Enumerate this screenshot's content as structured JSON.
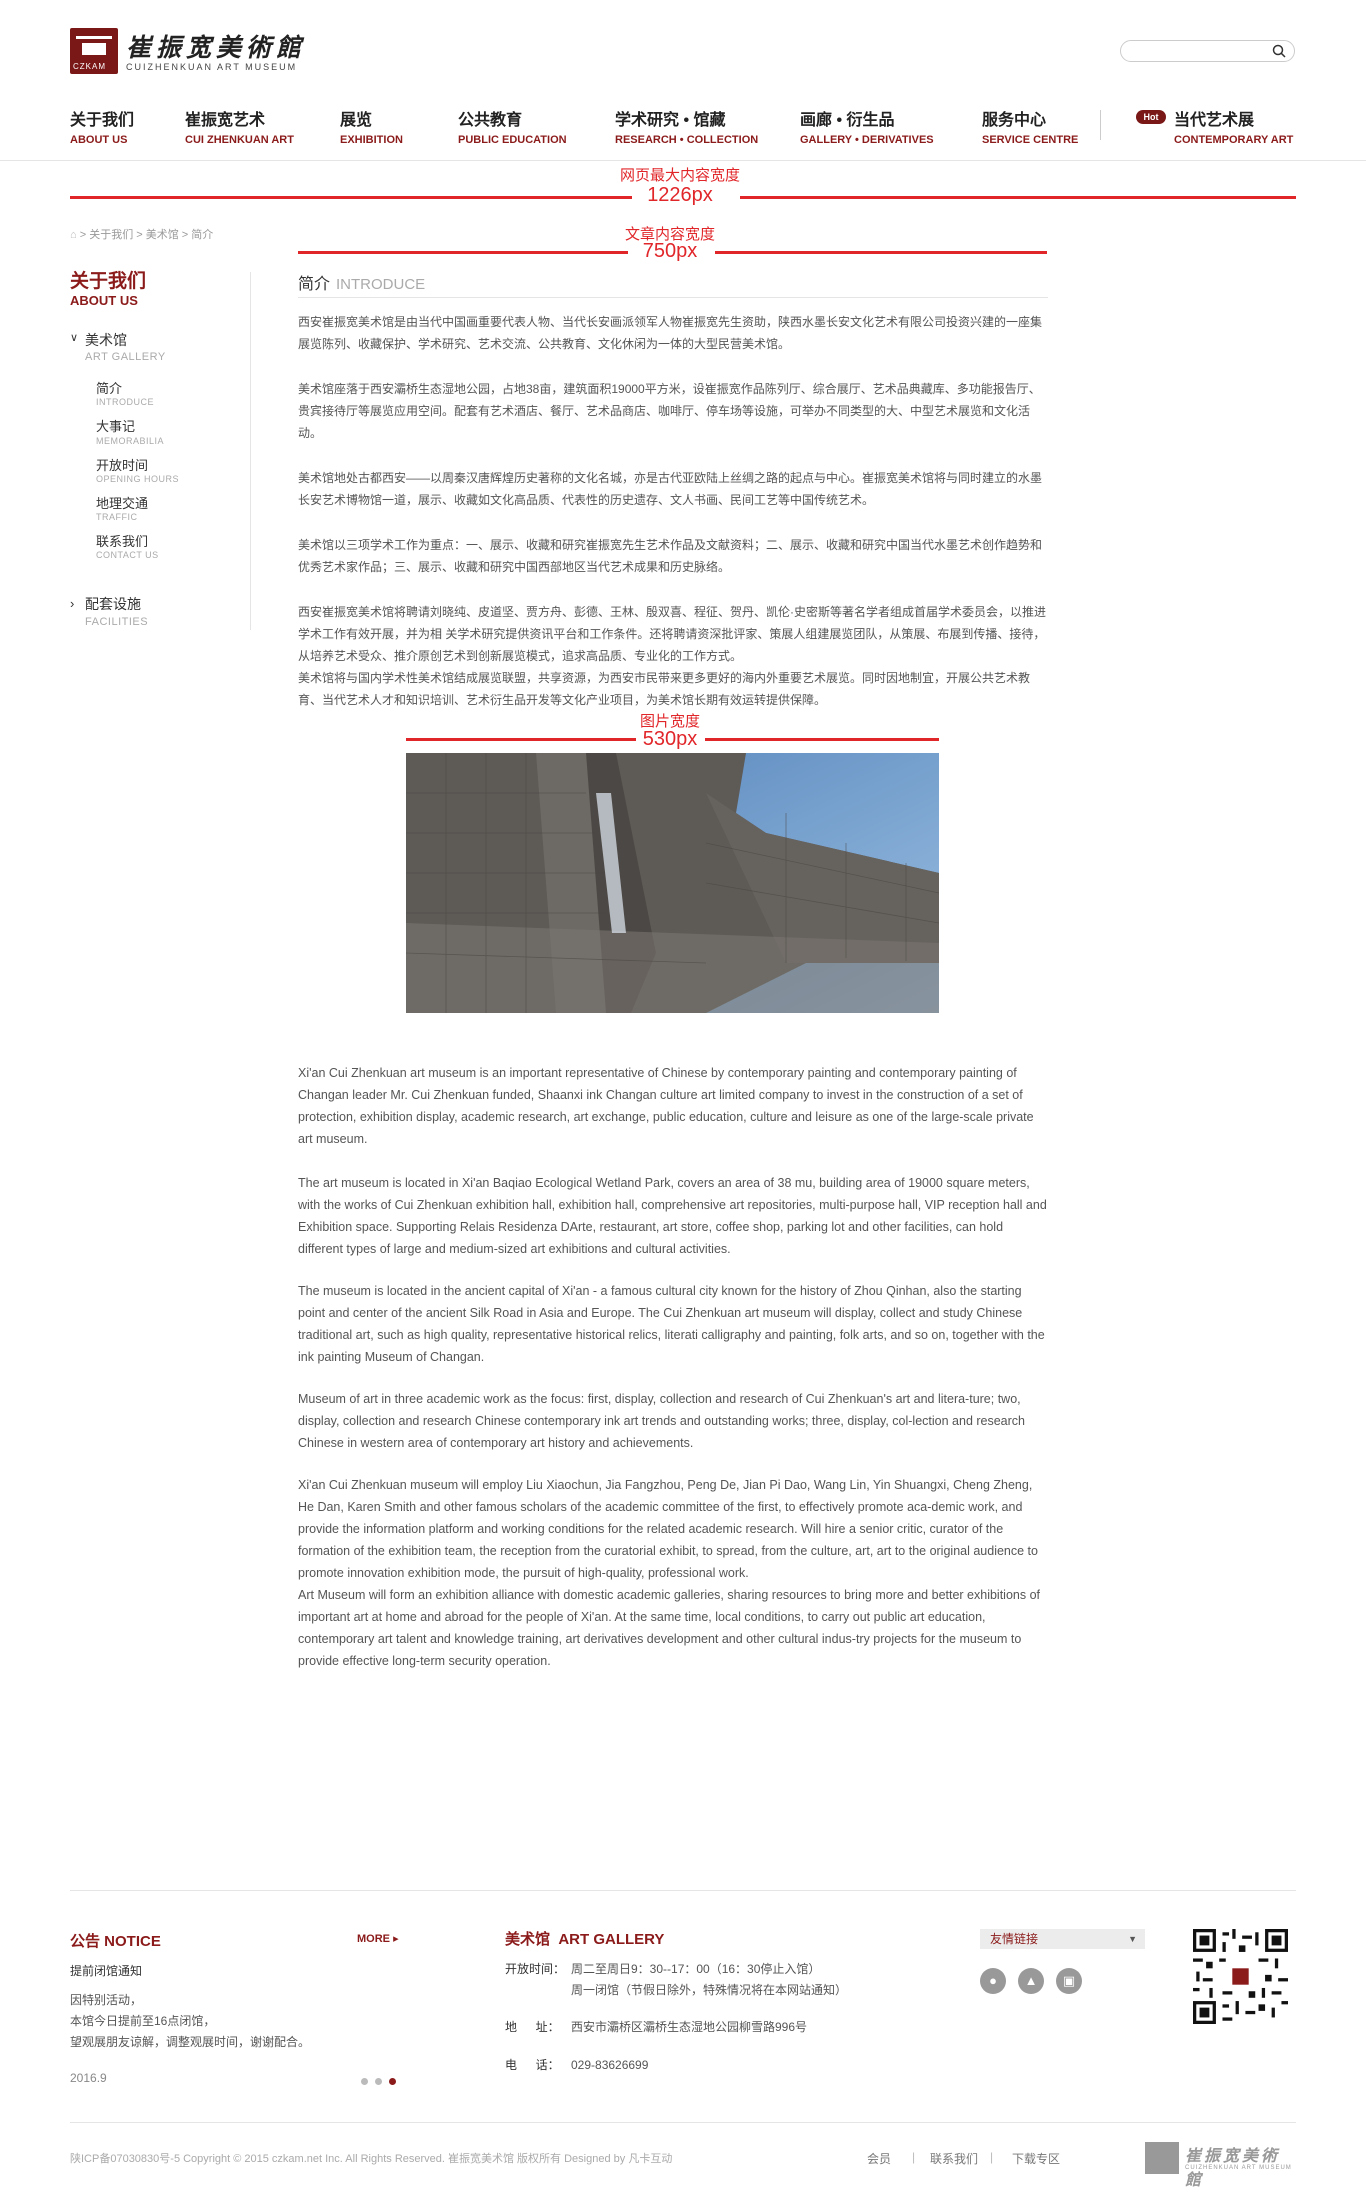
{
  "logo": {
    "cn": "崔振宽美術館",
    "en": "CUIZHENKUAN ART MUSEUM",
    "mark_text": "CZKAM"
  },
  "search": {
    "placeholder": ""
  },
  "nav": [
    {
      "cn": "关于我们",
      "en": "ABOUT US"
    },
    {
      "cn": "崔振宽艺术",
      "en": "CUI ZHENKUAN ART"
    },
    {
      "cn": "展览",
      "en": "EXHIBITION"
    },
    {
      "cn": "公共教育",
      "en": "PUBLIC EDUCATION"
    },
    {
      "cn": "学术研究 • 馆藏",
      "en": "RESEARCH • COLLECTION"
    },
    {
      "cn": "画廊 • 衍生品",
      "en": "GALLERY • DERIVATIVES"
    },
    {
      "cn": "服务中心",
      "en": "SERVICE CENTRE"
    },
    {
      "cn": "当代艺术展",
      "en": "CONTEMPORARY ART",
      "badge": "Hot"
    }
  ],
  "annotations": {
    "page_width_label": "网页最大内容宽度",
    "page_width_value": "1226px",
    "article_width_label": "文章内容宽度",
    "article_width_value": "750px",
    "image_width_label": "图片宽度",
    "image_width_value": "530px"
  },
  "breadcrumb": "> 关于我们 > 美术馆 > 简介",
  "sidebar": {
    "title_cn": "关于我们",
    "title_en": "ABOUT US",
    "group1": {
      "cn": "美术馆",
      "en": "ART GALLERY"
    },
    "items": [
      {
        "cn": "简介",
        "en": "INTRODUCE"
      },
      {
        "cn": "大事记",
        "en": "MEMORABILIA"
      },
      {
        "cn": "开放时间",
        "en": "OPENING HOURS"
      },
      {
        "cn": "地理交通",
        "en": "TRAFFIC"
      },
      {
        "cn": "联系我们",
        "en": "CONTACT US"
      }
    ],
    "group2": {
      "cn": "配套设施",
      "en": "FACILITIES"
    }
  },
  "article": {
    "title_cn": "简介",
    "title_en": "INTRODUCE",
    "cn_paragraphs": [
      "西安崔振宽美术馆是由当代中国画重要代表人物、当代长安画派领军人物崔振宽先生资助，陕西水墨长安文化艺术有限公司投资兴建的一座集展览陈列、收藏保护、学术研究、艺术交流、公共教育、文化休闲为一体的大型民营美术馆。",
      "美术馆座落于西安灞桥生态湿地公园，占地38亩，建筑面积19000平方米，设崔振宽作品陈列厅、综合展厅、艺术品典藏库、多功能报告厅、贵宾接待厅等展览应用空间。配套有艺术酒店、餐厅、艺术品商店、咖啡厅、停车场等设施，可举办不同类型的大、中型艺术展览和文化活动。",
      "美术馆地处古都西安——以周秦汉唐辉煌历史著称的文化名城，亦是古代亚欧陆上丝绸之路的起点与中心。崔振宽美术馆将与同时建立的水墨长安艺术博物馆一道，展示、收藏如文化高品质、代表性的历史遗存、文人书画、民间工艺等中国传统艺术。",
      "美术馆以三项学术工作为重点：一、展示、收藏和研究崔振宽先生艺术作品及文献资料；二、展示、收藏和研究中国当代水墨艺术创作趋势和优秀艺术家作品；三、展示、收藏和研究中国西部地区当代艺术成果和历史脉络。",
      "西安崔振宽美术馆将聘请刘晓纯、皮道坚、贾方舟、彭德、王林、殷双喜、程征、贺丹、凯伦·史密斯等著名学者组成首届学术委员会，以推进学术工作有效开展，并为相 关学术研究提供资讯平台和工作条件。还将聘请资深批评家、策展人组建展览团队，从策展、布展到传播、接待，从培养艺术受众、推介原创艺术到创新展览模式，追求高品质、专业化的工作方式。\n美术馆将与国内学术性美术馆结成展览联盟，共享资源，为西安市民带来更多更好的海内外重要艺术展览。同时因地制宜，开展公共艺术教育、当代艺术人才和知识培训、艺术衍生品开发等文化产业项目，为美术馆长期有效运转提供保障。"
    ],
    "en_paragraphs": [
      "Xi'an Cui Zhenkuan art museum is an important representative of Chinese by contemporary painting and contemporary painting of Changan leader Mr. Cui Zhenkuan funded, Shaanxi ink Changan culture art limited company to invest in the construction of a set of protection, exhibition display, academic research, art exchange, public education, culture and leisure as one of the large-scale private art museum.",
      "The art museum is located in Xi'an Baqiao Ecological Wetland Park, covers an area of 38 mu, building area of 19000 square meters, with the works of Cui Zhenkuan exhibition hall, exhibition hall, comprehensive art repositories, multi-purpose hall, VIP reception hall and Exhibition space. Supporting Relais Residenza DArte, restaurant, art store, coffee shop, parking lot and other facilities, can hold different types of large and medium-sized art exhibitions and cultural activities.",
      "The museum is located in the ancient capital of Xi'an - a famous cultural city known for the history of Zhou Qinhan, also the starting point and center of the ancient Silk Road in Asia and Europe. The Cui Zhenkuan art museum will display, collect and study Chinese traditional art, such as high quality, representative historical relics, literati calligraphy and painting, folk arts, and so on, together with the ink painting Museum of Changan.",
      "Museum of art in three academic work as the focus: first, display, collection and research of Cui Zhenkuan's art and litera-ture; two, display, collection and research Chinese contemporary ink art trends and outstanding works; three, display, col-lection and research Chinese in western area of contemporary art history and achievements.",
      "Xi'an Cui Zhenkuan museum will employ Liu Xiaochun, Jia Fangzhou, Peng De, Jian Pi Dao, Wang Lin, Yin Shuangxi, Cheng Zheng, He Dan, Karen Smith and other famous scholars of the academic committee of the first, to effectively promote aca-demic work, and provide the information platform and working conditions for the related academic research. Will hire a senior critic, curator of the formation of the exhibition team, the reception from the curatorial exhibit, to spread, from the culture, art, art to the original audience to promote innovation exhibition mode, the pursuit of high-quality, professional work.\nArt Museum will form an exhibition alliance with domestic academic galleries, sharing resources to bring more and better exhibitions of important art at home and abroad for the people of Xi'an. At the same time, local conditions, to carry out public art education, contemporary art talent and knowledge training, art derivatives development and other cultural indus-try projects for the museum to provide effective long-term security operation."
    ]
  },
  "footer": {
    "notice": {
      "title": "公告 NOTICE",
      "more": "MORE",
      "headline": "提前闭馆通知",
      "lines": [
        "因特别活动，",
        "本馆今日提前至16点闭馆，",
        "望观展朋友谅解，调整观展时间，谢谢配合。"
      ],
      "date": "2016.9"
    },
    "gallery": {
      "title": "美术馆  ART GALLERY",
      "hours_label": "开放时间：",
      "hours_1": "周二至周日9：30--17：00（16：30停止入馆）",
      "hours_2": "周一闭馆（节假日除外，特殊情况将在本网站通知）",
      "address_label": "地　  址：",
      "address": "西安市灞桥区灞桥生态湿地公园柳雪路996号",
      "phone_label": "电　  话：",
      "phone": "029-83626699"
    },
    "links_label": "友情链接",
    "copyright": "陕ICP备07030830号-5  Copyright © 2015 czkam.net Inc. All Rights Reserved. 崔振宽美术馆 版权所有  Designed by 凡卡互动",
    "bottom_links": [
      "会员",
      "联系我们",
      "下载专区"
    ]
  }
}
